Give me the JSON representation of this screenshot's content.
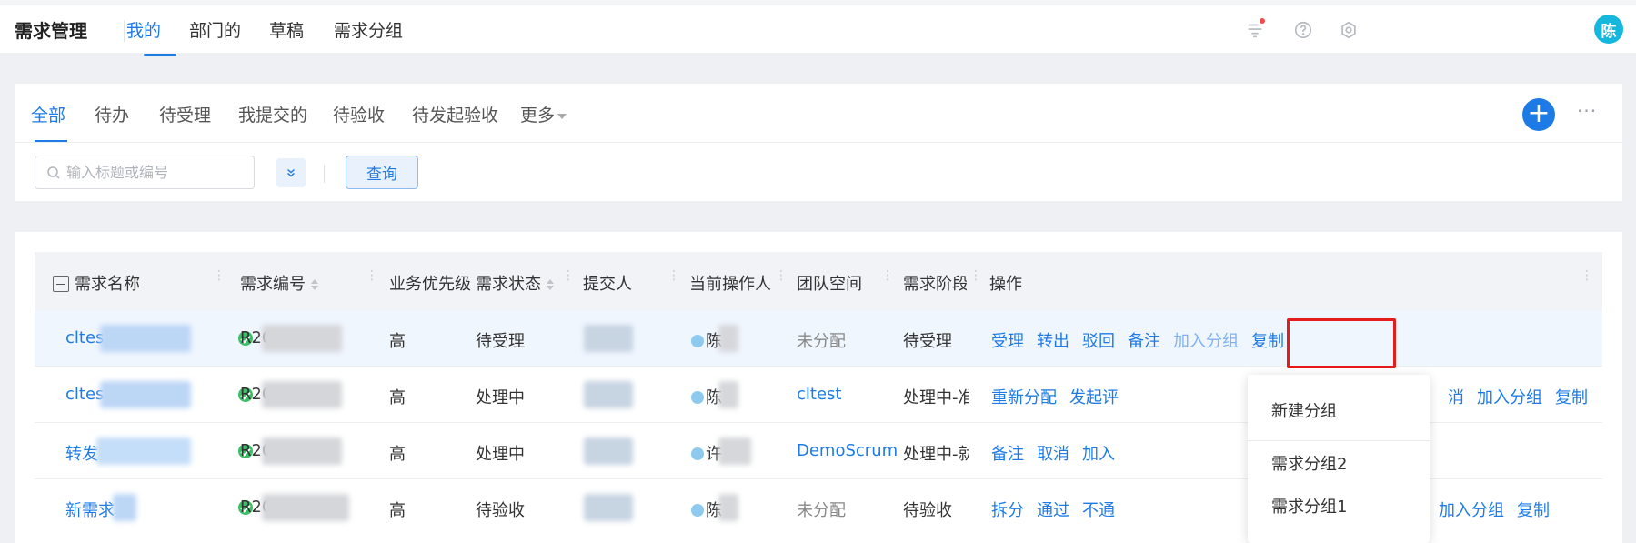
{
  "header": {
    "app_title": "需求管理",
    "tabs": [
      {
        "label": "我的",
        "active": true
      },
      {
        "label": "部门的",
        "active": false
      },
      {
        "label": "草稿",
        "active": false
      },
      {
        "label": "需求分组",
        "active": false
      }
    ],
    "icons": [
      "announcement-icon",
      "help-icon",
      "settings-icon"
    ],
    "avatar_text": "陈"
  },
  "filters": {
    "tabs": [
      {
        "label": "全部",
        "active": true
      },
      {
        "label": "待办"
      },
      {
        "label": "待受理"
      },
      {
        "label": "我提交的"
      },
      {
        "label": "待验收"
      },
      {
        "label": "待发起验收"
      },
      {
        "label": "更多"
      }
    ],
    "add_button": "+",
    "more_dots": "···",
    "search_placeholder": "输入标题或编号",
    "query_label": "查询"
  },
  "table": {
    "columns": [
      "需求名称",
      "需求编号",
      "业务优先级",
      "需求状态",
      "提交人",
      "当前操作人",
      "团队空间",
      "需求阶段",
      "操作"
    ],
    "rows": [
      {
        "name": "cltes",
        "number": "R20",
        "number_suffix": "...",
        "priority": "高",
        "status": "待受理",
        "operator": "陈",
        "team": "未分配",
        "team_is_link": false,
        "stage": "待受理",
        "actions": [
          "受理",
          "转出",
          "驳回",
          "备注",
          "加入分组",
          "复制"
        ]
      },
      {
        "name": "cltes",
        "number": "R20",
        "number_suffix": "..",
        "priority": "高",
        "status": "处理中",
        "operator": "陈",
        "team": "cltest",
        "team_is_link": true,
        "stage": "处理中-准备",
        "actions": [
          "重新分配",
          "发起评"
        ],
        "actions_right": [
          "消",
          "加入分组",
          "复制"
        ]
      },
      {
        "name": "转发",
        "number": "R20",
        "number_suffix": ".",
        "priority": "高",
        "status": "处理中",
        "operator": "许",
        "team": "DemoScrum",
        "team_is_link": true,
        "stage": "处理中-就绪",
        "actions": [
          "备注",
          "取消",
          "加入"
        ]
      },
      {
        "name": "新需求",
        "number": "R20",
        "number_suffix": "",
        "priority": "高",
        "status": "待验收",
        "operator": "陈",
        "team": "未分配",
        "team_is_link": false,
        "stage": "待验收",
        "actions": [
          "拆分",
          "通过",
          "不通"
        ],
        "actions_right": [
          "加入分组",
          "复制"
        ]
      }
    ]
  },
  "dropdown": {
    "items": [
      "新建分组",
      "需求分组2",
      "需求分组1"
    ]
  },
  "colors": {
    "accent": "#1e7be6",
    "highlight": "#e51c1c",
    "status_ok": "#3bbf67",
    "avatar": "#15b8dc"
  }
}
